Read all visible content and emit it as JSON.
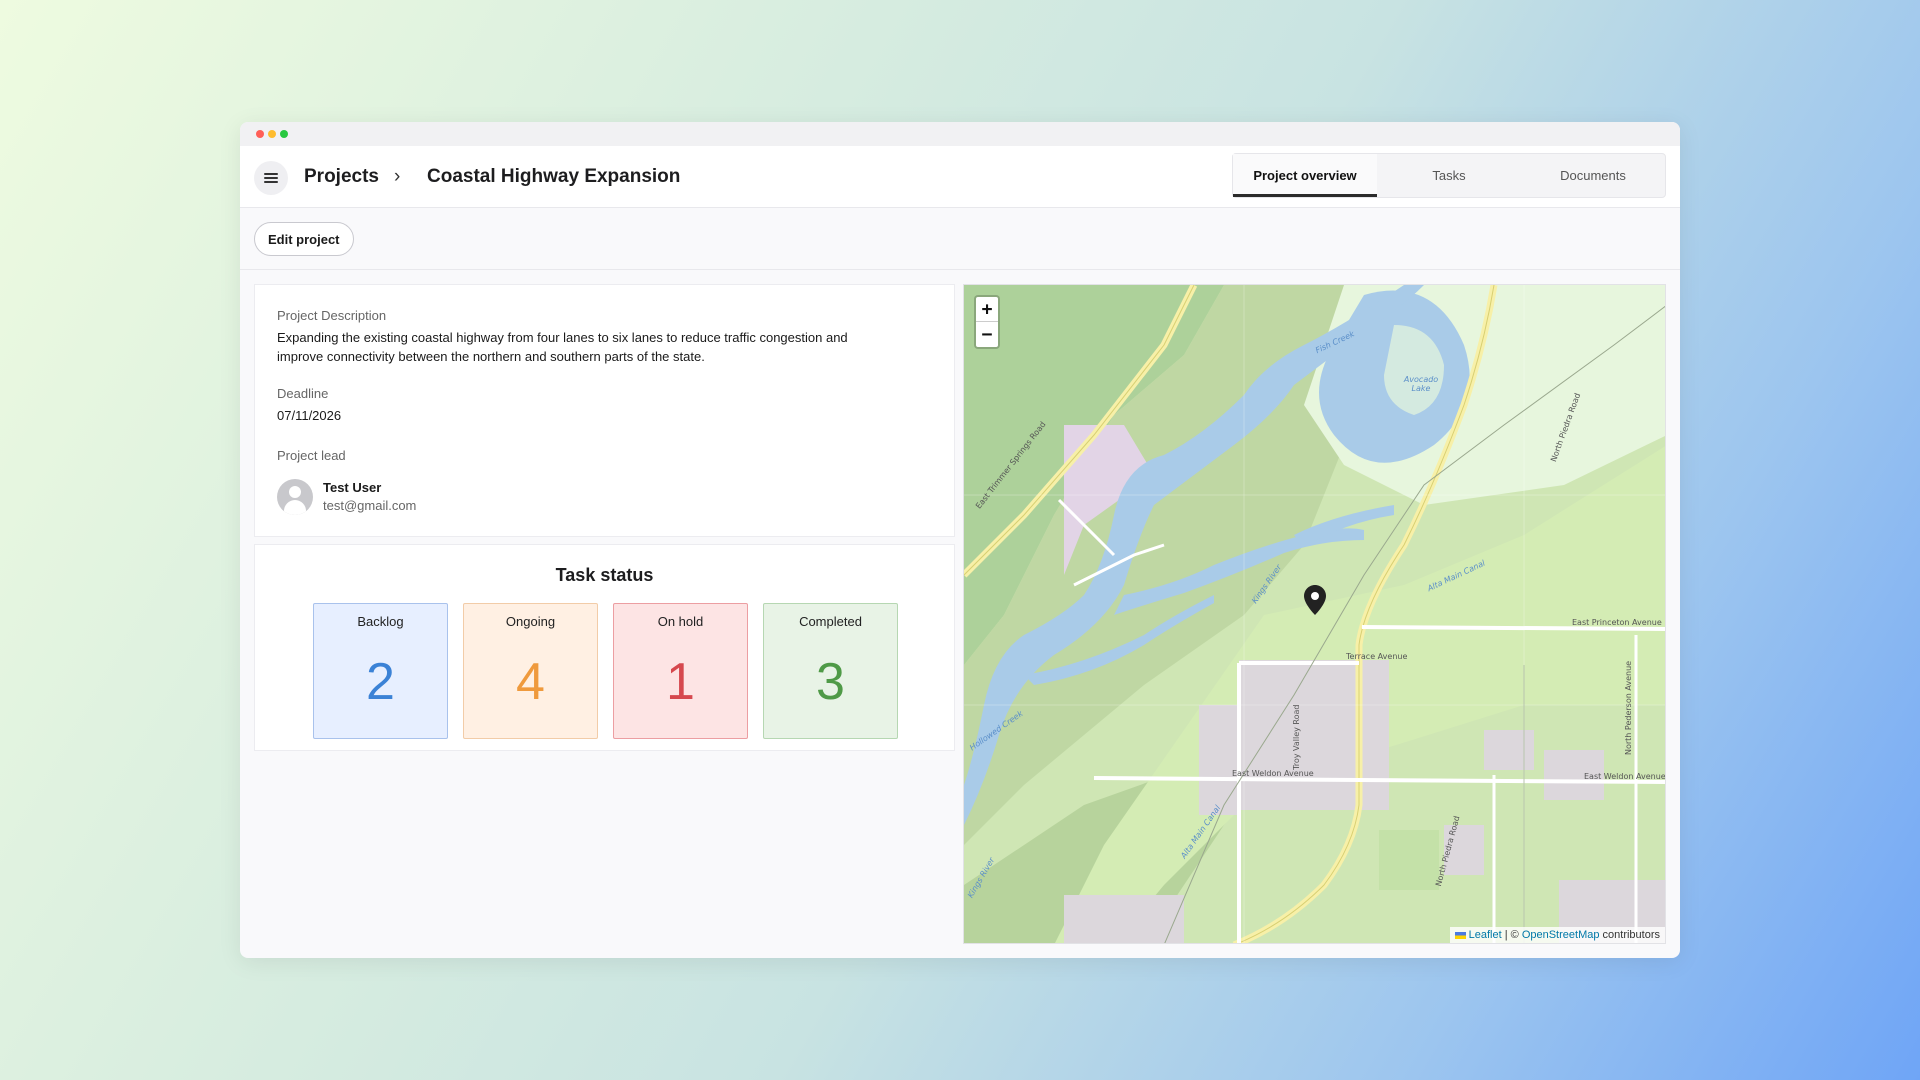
{
  "header": {
    "breadcrumb_root": "Projects",
    "breadcrumb_separator": "›",
    "breadcrumb_current": "Coastal Highway Expansion",
    "tabs": [
      {
        "label": "Project overview",
        "active": true
      },
      {
        "label": "Tasks",
        "active": false
      },
      {
        "label": "Documents",
        "active": false
      }
    ]
  },
  "toolbar": {
    "edit_label": "Edit project"
  },
  "project": {
    "description_label": "Project Description",
    "description": "Expanding the existing coastal highway from four lanes to six lanes to reduce traffic congestion and improve connectivity between the northern and southern parts of the state.",
    "deadline_label": "Deadline",
    "deadline": "07/11/2026",
    "lead_label": "Project lead",
    "lead_name": "Test User",
    "lead_email": "test@gmail.com"
  },
  "task_status": {
    "title": "Task status",
    "items": [
      {
        "label": "Backlog",
        "count": "2",
        "color": "#3b82d6"
      },
      {
        "label": "Ongoing",
        "count": "4",
        "color": "#ef9a3d"
      },
      {
        "label": "On hold",
        "count": "1",
        "color": "#d6484e"
      },
      {
        "label": "Completed",
        "count": "3",
        "color": "#4f9a47"
      }
    ]
  },
  "map": {
    "zoom_in": "+",
    "zoom_out": "−",
    "attribution_leaflet": "Leaflet",
    "attribution_sep": " | © ",
    "attribution_osm": "OpenStreetMap",
    "attribution_tail": " contributors",
    "labels": {
      "road_east_trimmer": "East Trimmer Springs Road",
      "road_north_piedra_top": "North Piedra Road",
      "road_north_piedra_bottom": "North Piedra Road",
      "road_east_princeton": "East Princeton Avenue",
      "road_terrace": "Terrace Avenue",
      "road_east_weldon_left": "East Weldon Avenue",
      "road_east_weldon_right": "East Weldon Avenue",
      "road_north_pederson": "North Pederson Avenue",
      "road_troy_valley": "Troy Valley Road",
      "water_avocado_lake": "Avocado Lake",
      "water_kings_river": "Kings River",
      "water_kings_river_sw": "Kings River",
      "water_alta_main": "Alta Main Canal",
      "water_alta_main_left": "Alta Main Canal",
      "water_fish_creek": "Fish Creek",
      "water_hollowed_creek": "Hollowed Creek"
    }
  }
}
